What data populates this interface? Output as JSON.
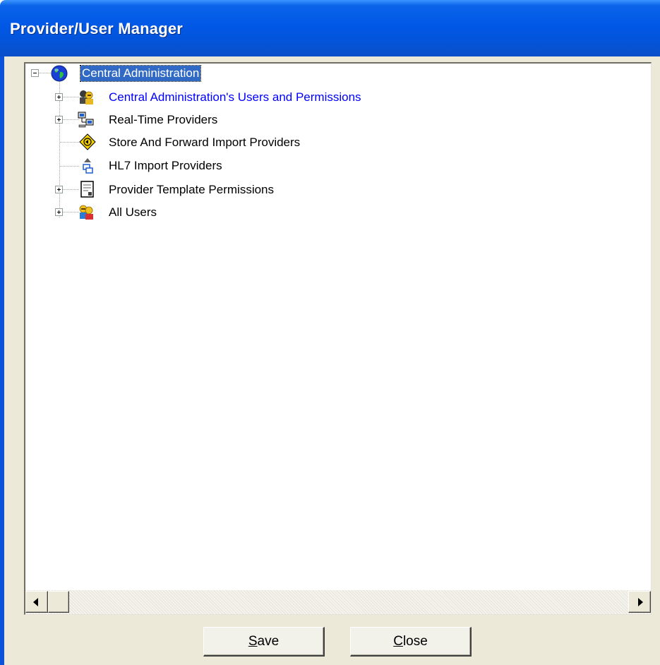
{
  "window": {
    "title": "Provider/User Manager"
  },
  "tree": {
    "root": {
      "label": "Central Administration",
      "icon": "globe-icon",
      "expanded": true,
      "selected": true
    },
    "children": [
      {
        "label": "Central Administration's Users and Permissions",
        "icon": "users-icon",
        "expandable": true,
        "color": "#0000ff"
      },
      {
        "label": "Real-Time Providers",
        "icon": "network-computers-icon",
        "expandable": true
      },
      {
        "label": "Store And Forward Import Providers",
        "icon": "road-sign-icon",
        "expandable": false
      },
      {
        "label": "HL7 Import Providers",
        "icon": "hl7-import-icon",
        "expandable": false
      },
      {
        "label": "Provider Template Permissions",
        "icon": "document-icon",
        "expandable": true
      },
      {
        "label": "All Users",
        "icon": "users-icon",
        "expandable": true
      }
    ]
  },
  "buttons": {
    "save": {
      "accel": "S",
      "rest": "ave"
    },
    "close": {
      "accel": "C",
      "rest": "lose"
    }
  },
  "colors": {
    "selection": "#316ac5",
    "titlebar": "#0058e6",
    "link": "#0000ff"
  }
}
